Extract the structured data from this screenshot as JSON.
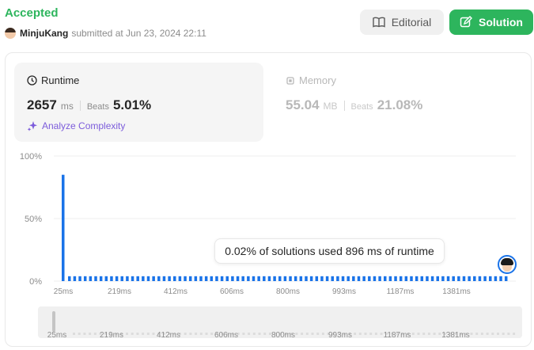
{
  "submission": {
    "status": "Accepted",
    "user": "MinjuKang",
    "submitted_text": "submitted at Jun 23, 2024 22:11"
  },
  "buttons": {
    "editorial_label": "Editorial",
    "solution_label": "Solution"
  },
  "runtime": {
    "title": "Runtime",
    "value": "2657",
    "unit": "ms",
    "beats_label": "Beats",
    "beats_pct": "5.01%",
    "analyze_label": "Analyze Complexity"
  },
  "memory": {
    "title": "Memory",
    "value": "55.04",
    "unit": "MB",
    "beats_label": "Beats",
    "beats_pct": "21.08%"
  },
  "tooltip": {
    "text": "0.02% of solutions used 896 ms of runtime"
  },
  "colors": {
    "accent_green": "#2db55d",
    "bar_blue": "#1a73e8",
    "analyze_purple": "#7c5cdb"
  },
  "chart_data": {
    "type": "bar",
    "y_ticks": [
      "100%",
      "50%",
      "0%"
    ],
    "ylim": [
      0,
      100
    ],
    "x_tick_labels": [
      "25ms",
      "219ms",
      "412ms",
      "606ms",
      "800ms",
      "993ms",
      "1187ms",
      "1381ms"
    ],
    "first_bar_value": 85,
    "tail_bar_value": 2,
    "tail_bar_count": 84,
    "navigator_labels": [
      "25ms",
      "219ms",
      "412ms",
      "606ms",
      "800ms",
      "993ms",
      "1187ms",
      "1381ms"
    ]
  }
}
